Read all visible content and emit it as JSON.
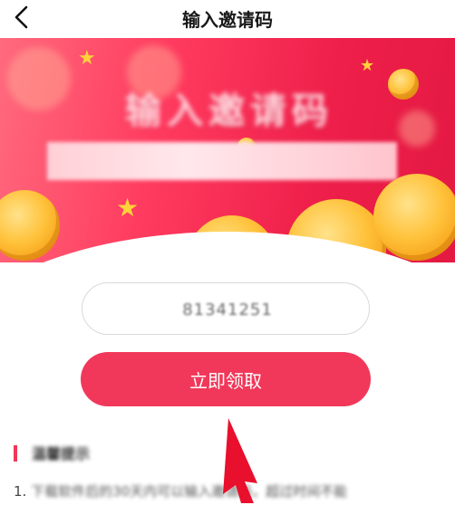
{
  "header": {
    "title": "输入邀请码"
  },
  "banner": {
    "heading": "输入邀请码"
  },
  "form": {
    "code_value": "81341251",
    "claim_label": "立即领取"
  },
  "tips": {
    "title": "温馨提示",
    "line1_number": "1.",
    "line1_text": "下载软件后的30天内可以输入邀请码，超过时间不能"
  },
  "colors": {
    "accent": "#f1385a",
    "banner": "#ee1f4a"
  },
  "icons": {
    "back": "chevron-left-icon"
  }
}
